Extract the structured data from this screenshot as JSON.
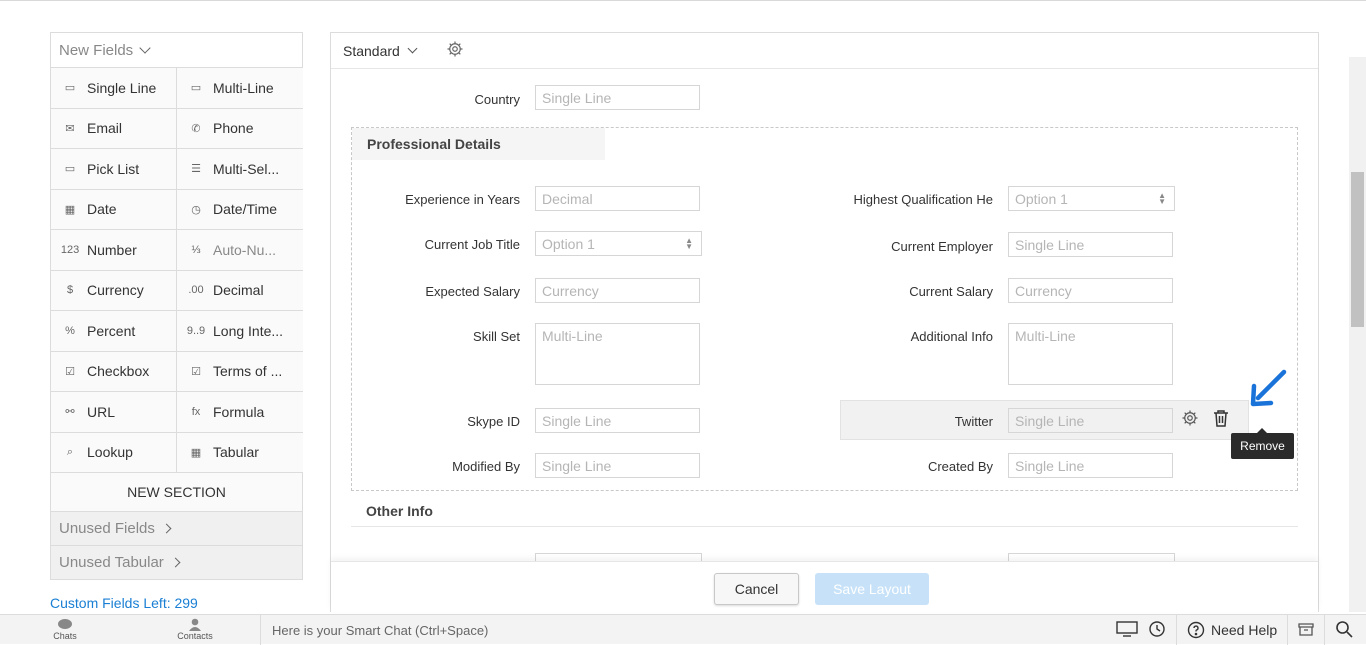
{
  "palette": {
    "header": "New Fields",
    "fields": [
      {
        "label": "Single Line",
        "icon": "single-line-icon",
        "glyph": "▭"
      },
      {
        "label": "Multi-Line",
        "icon": "multi-line-icon",
        "glyph": "▭"
      },
      {
        "label": "Email",
        "icon": "email-icon",
        "glyph": "✉"
      },
      {
        "label": "Phone",
        "icon": "phone-icon",
        "glyph": "✆"
      },
      {
        "label": "Pick List",
        "icon": "pick-list-icon",
        "glyph": "▭"
      },
      {
        "label": "Multi-Sel...",
        "icon": "multi-select-icon",
        "glyph": "☰"
      },
      {
        "label": "Date",
        "icon": "date-icon",
        "glyph": "▦"
      },
      {
        "label": "Date/Time",
        "icon": "date-time-icon",
        "glyph": "◷"
      },
      {
        "label": "Number",
        "icon": "number-icon",
        "glyph": "123"
      },
      {
        "label": "Auto-Nu...",
        "icon": "auto-number-icon",
        "glyph": "⅓"
      },
      {
        "label": "Currency",
        "icon": "currency-icon",
        "glyph": "$"
      },
      {
        "label": "Decimal",
        "icon": "decimal-icon",
        "glyph": ".00"
      },
      {
        "label": "Percent",
        "icon": "percent-icon",
        "glyph": "%"
      },
      {
        "label": "Long Inte...",
        "icon": "long-integer-icon",
        "glyph": "9..9"
      },
      {
        "label": "Checkbox",
        "icon": "checkbox-icon",
        "glyph": "☑"
      },
      {
        "label": "Terms of ...",
        "icon": "terms-icon",
        "glyph": "☑"
      },
      {
        "label": "URL",
        "icon": "url-icon",
        "glyph": "⚯"
      },
      {
        "label": "Formula",
        "icon": "formula-icon",
        "glyph": "fx"
      },
      {
        "label": "Lookup",
        "icon": "lookup-icon",
        "glyph": "⌕"
      },
      {
        "label": "Tabular",
        "icon": "tabular-icon",
        "glyph": "▦"
      }
    ],
    "new_section": "NEW SECTION",
    "unused_fields": "Unused Fields",
    "unused_tabular": "Unused Tabular",
    "custom_fields_left": "Custom Fields Left: 299"
  },
  "form": {
    "layout_name": "Standard",
    "country_label": "Country",
    "country_placeholder": "Single Line",
    "section_title": "Professional Details",
    "fields": {
      "experience_label": "Experience in Years",
      "experience_ph": "Decimal",
      "highest_qual_label": "Highest Qualification He",
      "highest_qual_ph": "Option 1",
      "job_title_label": "Current Job Title",
      "job_title_ph": "Option 1",
      "employer_label": "Current Employer",
      "employer_ph": "Single Line",
      "expected_salary_label": "Expected Salary",
      "expected_salary_ph": "Currency",
      "current_salary_label": "Current Salary",
      "current_salary_ph": "Currency",
      "skill_set_label": "Skill Set",
      "skill_set_ph": "Multi-Line",
      "additional_info_label": "Additional Info",
      "additional_info_ph": "Multi-Line",
      "skype_label": "Skype ID",
      "skype_ph": "Single Line",
      "twitter_label": "Twitter",
      "twitter_ph": "Single Line",
      "modified_by_label": "Modified By",
      "modified_by_ph": "Single Line",
      "created_by_label": "Created By",
      "created_by_ph": "Single Line"
    },
    "tooltip": "Remove",
    "other_section_title": "Other Info",
    "cancel_label": "Cancel",
    "save_label": "Save Layout"
  },
  "bottom_bar": {
    "chats": "Chats",
    "contacts": "Contacts",
    "smart_chat_placeholder": "Here is your Smart Chat (Ctrl+Space)",
    "need_help": "Need Help"
  },
  "colors": {
    "accent": "#1a7fd4",
    "save_disabled": "#c7e2f8",
    "arrow": "#1a73d9"
  }
}
